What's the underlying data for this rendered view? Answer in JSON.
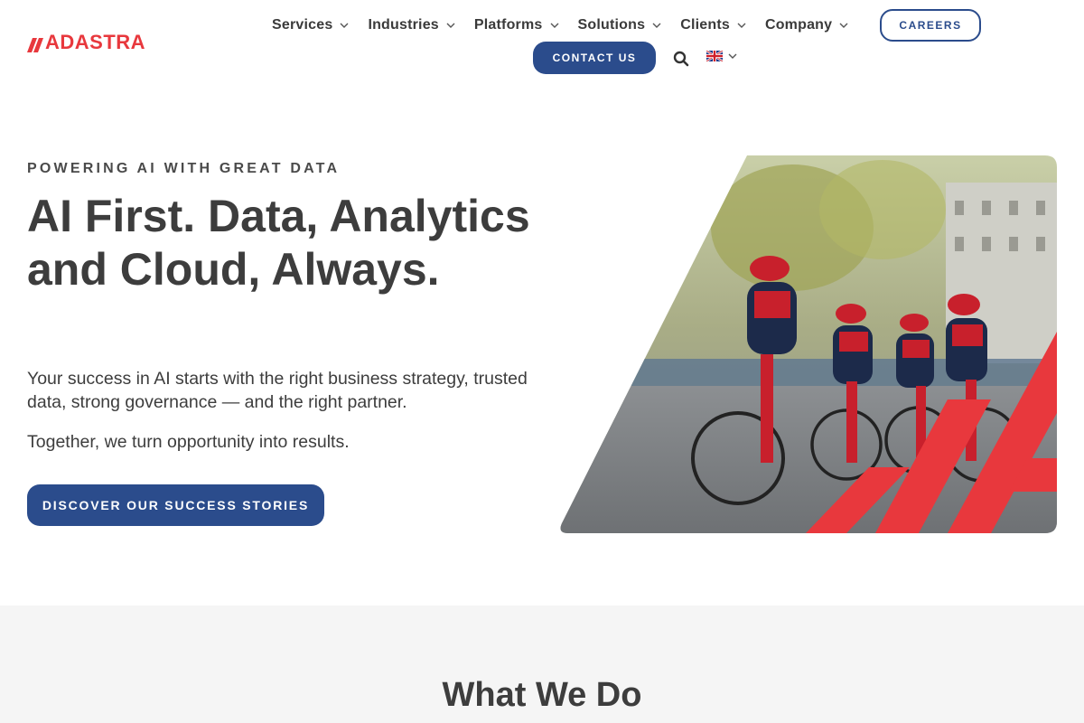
{
  "brand": {
    "name": "ADASTRA",
    "color": "#e8383d"
  },
  "nav": {
    "items": [
      {
        "label": "Services"
      },
      {
        "label": "Industries"
      },
      {
        "label": "Platforms"
      },
      {
        "label": "Solutions"
      },
      {
        "label": "Clients"
      },
      {
        "label": "Company"
      }
    ],
    "careers_label": "CAREERS",
    "contact_label": "CONTACT US",
    "language": "en-GB flag"
  },
  "hero": {
    "eyebrow": "POWERING AI WITH GREAT DATA",
    "title": "AI First. Data, Analytics and Cloud, Always.",
    "subtitle": "Your success in AI starts with the right business strategy, trusted data, strong governance — and the right partner.",
    "subtitle2": "Together, we turn opportunity into results.",
    "cta_label": "DISCOVER OUR SUCCESS STORIES",
    "image_subject": "cyclists racing"
  },
  "what_we_do": {
    "title": "What We Do"
  },
  "colors": {
    "primary": "#2b4c8c",
    "accent": "#e8383d",
    "text": "#3d3d3d"
  },
  "icons": {
    "search": "search-icon",
    "chevron": "chevron-down-icon",
    "flag": "uk-flag-icon"
  }
}
